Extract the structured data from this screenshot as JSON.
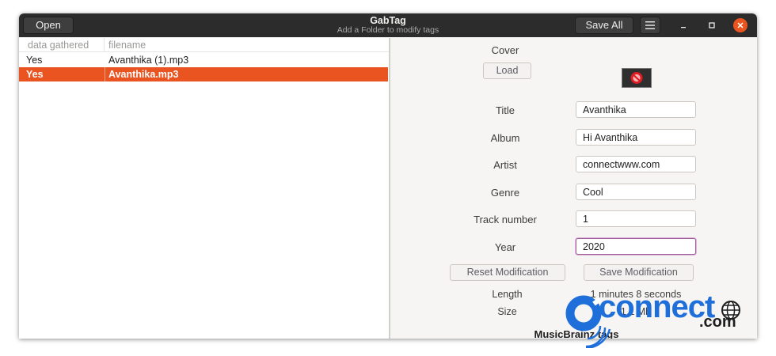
{
  "header": {
    "open_label": "Open",
    "title": "GabTag",
    "subtitle": "Add a Folder to modify tags",
    "save_all_label": "Save All"
  },
  "files": {
    "columns": [
      "data gathered",
      "filename"
    ],
    "rows": [
      {
        "gathered": "Yes",
        "filename": "Avanthika (1).mp3"
      },
      {
        "gathered": "Yes",
        "filename": "Avanthika.mp3"
      }
    ]
  },
  "editor": {
    "cover_label": "Cover",
    "load_label": "Load",
    "title_label": "Title",
    "title_value": "Avanthika",
    "album_label": "Album",
    "album_value": "Hi Avanthika",
    "artist_label": "Artist",
    "artist_value": "connectwww.com",
    "genre_label": "Genre",
    "genre_value": "Cool",
    "track_label": "Track number",
    "track_value": "1",
    "year_label": "Year",
    "year_value": "2020",
    "reset_label": "Reset Modification",
    "save_label": "Save Modification",
    "length_label": "Length",
    "length_value": "1 minutes 8 seconds",
    "size_label": "Size",
    "size_value": "1.1 Mb",
    "musicbrainz_label": "MusicBrainz tags"
  },
  "watermark": {
    "text": "connect",
    "domain": ".com"
  },
  "colors": {
    "accent": "#e95420",
    "headerbar": "#2c2c2c"
  }
}
